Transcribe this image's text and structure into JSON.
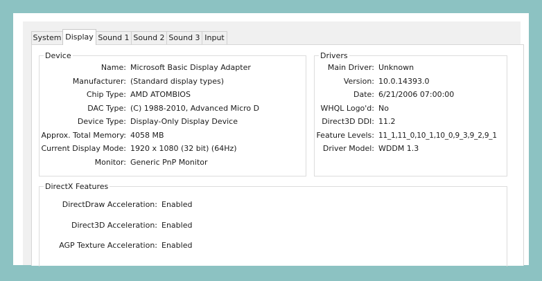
{
  "tabs": [
    "System",
    "Display",
    "Sound 1",
    "Sound 2",
    "Sound 3",
    "Input"
  ],
  "active_tab": "Display",
  "device": {
    "title": "Device",
    "rows": [
      {
        "label": "Name:",
        "value": "Microsoft Basic Display Adapter"
      },
      {
        "label": "Manufacturer:",
        "value": "(Standard display types)"
      },
      {
        "label": "Chip Type:",
        "value": "AMD ATOMBIOS"
      },
      {
        "label": "DAC Type:",
        "value": "(C) 1988-2010, Advanced Micro D"
      },
      {
        "label": "Device Type:",
        "value": "Display-Only Display Device"
      },
      {
        "label": "Approx. Total Memory:",
        "value": "4058 MB"
      },
      {
        "label": "Current Display Mode:",
        "value": "1920 x 1080 (32 bit) (64Hz)"
      },
      {
        "label": "Monitor:",
        "value": "Generic PnP Monitor"
      }
    ]
  },
  "drivers": {
    "title": "Drivers",
    "rows": [
      {
        "label": "Main Driver:",
        "value": "Unknown"
      },
      {
        "label": "Version:",
        "value": "10.0.14393.0"
      },
      {
        "label": "Date:",
        "value": "6/21/2006 07:00:00"
      },
      {
        "label": "WHQL Logo'd:",
        "value": "No"
      },
      {
        "label": "Direct3D DDI:",
        "value": "11.2"
      },
      {
        "label": "Feature Levels:",
        "value": "11_1,11_0,10_1,10_0,9_3,9_2,9_1"
      },
      {
        "label": "Driver Model:",
        "value": "WDDM 1.3"
      }
    ]
  },
  "directx": {
    "title": "DirectX Features",
    "rows": [
      {
        "label": "DirectDraw Acceleration:",
        "value": "Enabled"
      },
      {
        "label": "Direct3D Acceleration:",
        "value": "Enabled"
      },
      {
        "label": "AGP Texture Acceleration:",
        "value": "Enabled"
      }
    ]
  }
}
